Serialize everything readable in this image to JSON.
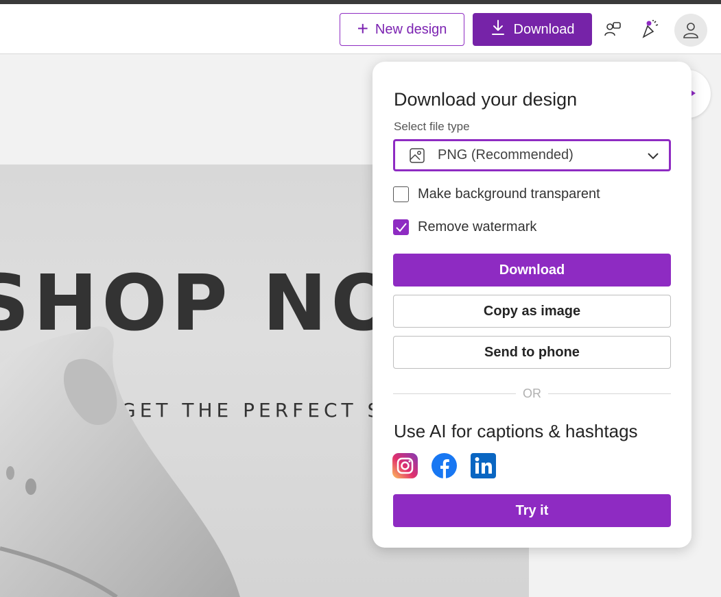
{
  "header": {
    "new_design_label": "New design",
    "download_label": "Download",
    "icons": [
      "feedback-icon",
      "celebrate-icon",
      "account-icon"
    ]
  },
  "design": {
    "headline": "SHOP NO",
    "tagline": "GET THE PERFECT S"
  },
  "download_panel": {
    "title": "Download your design",
    "file_type_label": "Select file type",
    "file_type_value": "PNG (Recommended)",
    "options": [
      {
        "label": "Make background transparent",
        "checked": false
      },
      {
        "label": "Remove watermark",
        "checked": true
      }
    ],
    "download_label": "Download",
    "copy_label": "Copy as image",
    "send_label": "Send to phone",
    "or_label": "OR",
    "ai_title": "Use AI for captions & hashtags",
    "socials": [
      "instagram-icon",
      "facebook-icon",
      "linkedin-icon"
    ],
    "try_label": "Try it"
  },
  "colors": {
    "accent": "#8e2bc2",
    "accent_dark": "#7623a8"
  }
}
